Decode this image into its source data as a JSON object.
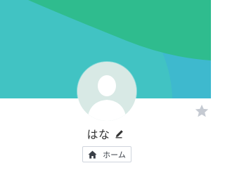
{
  "profile": {
    "name": "はな",
    "home_label": "ホーム"
  },
  "icons": {
    "avatar": "default-person-avatar",
    "edit": "pencil-icon",
    "home": "house-icon",
    "favorite": "star-icon"
  },
  "colors": {
    "cover_base": "#41c3c3",
    "cover_shape": "#2fbc8e",
    "cover_arc": "#3fb4d6",
    "avatar_bg": "#d8e9e5",
    "avatar_figure": "#ffffff",
    "star": "#c5cad2",
    "chip_border": "#cfd4dc",
    "text": "#333333"
  }
}
